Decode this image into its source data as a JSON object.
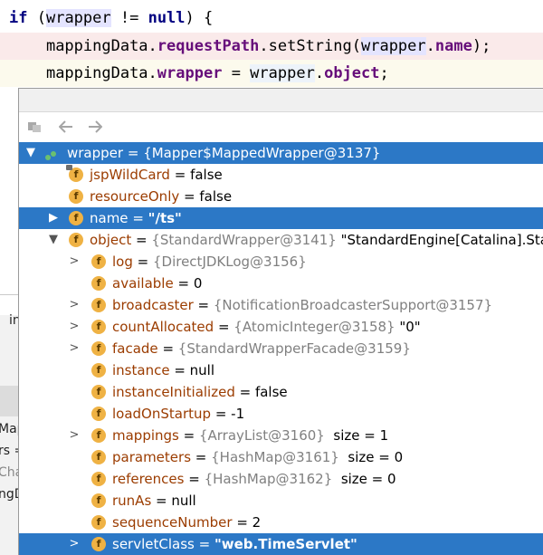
{
  "code": {
    "line1": {
      "kw_if": "if",
      "open": " (",
      "var": "wrapper",
      "op": " != ",
      "kw_null": "null",
      "close": ") {"
    },
    "line2": {
      "indent": "    ",
      "obj": "mappingData",
      "dot1": ".",
      "field": "requestPath",
      "call": ".setString(",
      "arg": "wrapper",
      "dot2": ".",
      "argfield": "name",
      "end": ");"
    },
    "line3": {
      "indent": "    ",
      "obj": "mappingData",
      "dot1": ".",
      "field": "wrapper",
      "eq": " = ",
      "arg": "wrapper",
      "dot2": ".",
      "argfield": "object",
      "end": ";"
    }
  },
  "side_fragments": [
    "in",
    "Map",
    "rs =",
    "Cha",
    "ngDa"
  ],
  "toolbar": {
    "icons": [
      "frame-icon",
      "back-arrow-icon",
      "forward-arrow-icon"
    ]
  },
  "tree": {
    "root": {
      "name": "wrapper",
      "eq": " = ",
      "value": "{Mapper$MappedWrapper@3137}"
    },
    "level1": [
      {
        "name": "jspWildCard",
        "eq": " = ",
        "value": "false"
      },
      {
        "name": "resourceOnly",
        "eq": " = ",
        "value": "false"
      },
      {
        "name": "name",
        "eq": " = ",
        "value": "\"/ts\""
      },
      {
        "name": "object",
        "eq": " = ",
        "ref": "{StandardWrapper@3141}",
        "value": " \"StandardEngine[Catalina].Standa"
      }
    ],
    "object_children": [
      {
        "name": "log",
        "eq": " = ",
        "ref": "{DirectJDKLog@3156}",
        "value": ""
      },
      {
        "name": "available",
        "eq": " = ",
        "ref": "",
        "value": "0"
      },
      {
        "name": "broadcaster",
        "eq": " = ",
        "ref": "{NotificationBroadcasterSupport@3157}",
        "value": ""
      },
      {
        "name": "countAllocated",
        "eq": " = ",
        "ref": "{AtomicInteger@3158}",
        "value": " \"0\""
      },
      {
        "name": "facade",
        "eq": " = ",
        "ref": "{StandardWrapperFacade@3159}",
        "value": ""
      },
      {
        "name": "instance",
        "eq": " = ",
        "ref": "",
        "value": "null"
      },
      {
        "name": "instanceInitialized",
        "eq": " = ",
        "ref": "",
        "value": "false"
      },
      {
        "name": "loadOnStartup",
        "eq": " = ",
        "ref": "",
        "value": "-1"
      },
      {
        "name": "mappings",
        "eq": " = ",
        "ref": "{ArrayList@3160}",
        "value": "  size = 1"
      },
      {
        "name": "parameters",
        "eq": " = ",
        "ref": "{HashMap@3161}",
        "value": "  size = 0"
      },
      {
        "name": "references",
        "eq": " = ",
        "ref": "{HashMap@3162}",
        "value": "  size = 0"
      },
      {
        "name": "runAs",
        "eq": " = ",
        "ref": "",
        "value": "null"
      },
      {
        "name": "sequenceNumber",
        "eq": " = ",
        "ref": "",
        "value": "2"
      },
      {
        "name": "servletClass",
        "eq": " = ",
        "ref": "",
        "value": "\"web.TimeServlet\""
      }
    ]
  },
  "colors": {
    "selection": "#2c78c6",
    "field_icon": "#efb244",
    "field_name": "#9b3c00",
    "ref_gray": "#808080"
  }
}
